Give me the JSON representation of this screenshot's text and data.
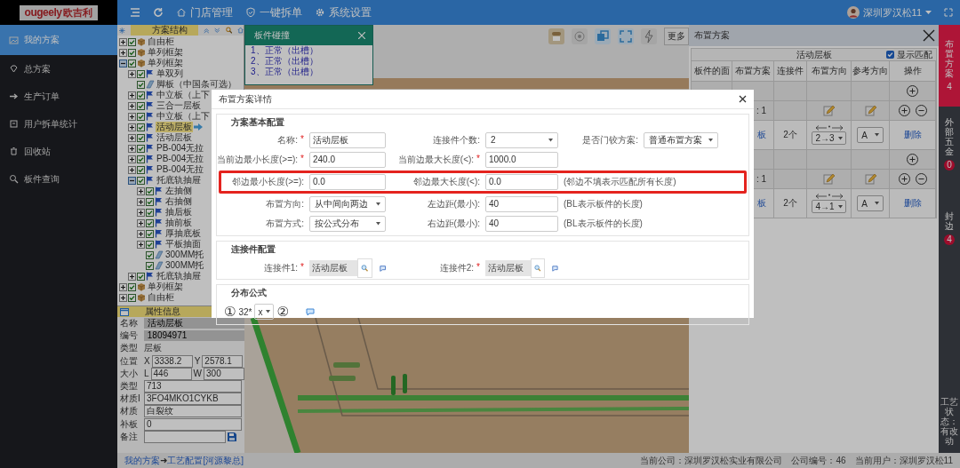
{
  "logo": {
    "wordmark": "ougeely",
    "brand": "欧吉利"
  },
  "nav": [
    {
      "label": "我的方案",
      "selected": true
    },
    {
      "label": "总方案",
      "selected": false
    },
    {
      "label": "生产订单",
      "selected": false
    },
    {
      "label": "用户拆单统计",
      "selected": false
    },
    {
      "label": "回收站",
      "selected": false
    },
    {
      "label": "板件查询",
      "selected": false
    }
  ],
  "topbar": {
    "menus": [
      "门店管理",
      "一键拆单",
      "系统设置"
    ],
    "user": "深圳罗汉松11"
  },
  "tree": {
    "title": "方案结构",
    "items": [
      {
        "name": "自由柜",
        "kind": "group",
        "checked": true,
        "expanded": false,
        "selected": false
      },
      {
        "name": "单列框架",
        "kind": "group",
        "checked": true,
        "expanded": false,
        "selected": false
      },
      {
        "name": "单列框架",
        "kind": "group",
        "checked": true,
        "expanded": true,
        "selected": false,
        "children": [
          {
            "name": "单双列",
            "kind": "flag",
            "checked": true,
            "expanded": false,
            "selected": false
          },
          {
            "name": "脚板（中国条可选）",
            "kind": "board",
            "checked": true,
            "selected": false
          },
          {
            "name": "中立板（上下",
            "kind": "flag",
            "checked": true,
            "expanded": false,
            "selected": false
          },
          {
            "name": "三合一层板",
            "kind": "flag",
            "checked": true,
            "expanded": false,
            "selected": false
          },
          {
            "name": "中立板（上下",
            "kind": "flag",
            "checked": true,
            "expanded": false,
            "selected": false
          },
          {
            "name": "活动层板",
            "kind": "flag",
            "checked": true,
            "expanded": false,
            "selected": true
          },
          {
            "name": "活动层板",
            "kind": "flag",
            "checked": true,
            "expanded": false,
            "selected": false
          },
          {
            "name": "PB-004无拉",
            "kind": "flag",
            "checked": true,
            "expanded": false,
            "selected": false
          },
          {
            "name": "PB-004无拉",
            "kind": "flag",
            "checked": true,
            "expanded": false,
            "selected": false
          },
          {
            "name": "PB-004无拉",
            "kind": "flag",
            "checked": true,
            "expanded": false,
            "selected": false
          },
          {
            "name": "托底轨抽屉",
            "kind": "flag",
            "checked": true,
            "expanded": true,
            "selected": false,
            "children": [
              {
                "name": "左抽侧",
                "kind": "flag",
                "checked": true,
                "expanded": false,
                "selected": false
              },
              {
                "name": "右抽侧",
                "kind": "flag",
                "checked": true,
                "expanded": false,
                "selected": false
              },
              {
                "name": "抽后板",
                "kind": "flag",
                "checked": true,
                "expanded": false,
                "selected": false
              },
              {
                "name": "抽前板",
                "kind": "flag",
                "checked": true,
                "expanded": false,
                "selected": false
              },
              {
                "name": "厚抽底板",
                "kind": "flag",
                "checked": true,
                "expanded": false,
                "selected": false
              },
              {
                "name": "平板抽面",
                "kind": "flag",
                "checked": true,
                "expanded": false,
                "selected": false
              },
              {
                "name": "300MM托",
                "kind": "board",
                "checked": true,
                "selected": false
              },
              {
                "name": "300MM托",
                "kind": "board",
                "checked": true,
                "selected": false
              }
            ]
          },
          {
            "name": "托底轨抽屉",
            "kind": "flag",
            "checked": true,
            "expanded": false,
            "selected": false
          }
        ]
      },
      {
        "name": "单列框架",
        "kind": "group",
        "checked": true,
        "expanded": false,
        "selected": false
      },
      {
        "name": "自由柜",
        "kind": "group",
        "checked": true,
        "expanded": false,
        "selected": false
      }
    ]
  },
  "properties": {
    "title": "属性信息",
    "rows": [
      {
        "label": "名称",
        "kind": "readonly",
        "value": "活动层板"
      },
      {
        "label": "编号",
        "kind": "readonly",
        "value": "18094971"
      },
      {
        "label": "类型",
        "kind": "text",
        "value": "层板"
      },
      {
        "label": "位置",
        "kind": "pair",
        "a_label": "X",
        "a": "3338.2",
        "b_label": "Y",
        "b": "2578.1"
      },
      {
        "label": "大小",
        "kind": "pair",
        "a_label": "L",
        "a": "446",
        "b_label": "W",
        "b": "300"
      },
      {
        "label": "类型",
        "kind": "input",
        "value": "713"
      },
      {
        "label": "材质I",
        "kind": "input",
        "value": "3FO4MKO1CYKB"
      },
      {
        "label": "材质",
        "kind": "input",
        "value": "白裂纹"
      },
      {
        "label": "补板",
        "kind": "input",
        "value": "0"
      },
      {
        "label": "备注",
        "kind": "note"
      }
    ]
  },
  "collision": {
    "title": "板件碰撞",
    "items": [
      "1、正常（出槽）",
      "2、正常（出槽）",
      "3、正常（出槽）"
    ]
  },
  "toolbar": {
    "more": "更多"
  },
  "layout_panel": {
    "title": "布置方案",
    "table_title": "活动层板",
    "show_match": {
      "label": "显示匹配",
      "checked": true
    },
    "columns": [
      "板件的面",
      "布置方案",
      "连接件",
      "布置方向",
      "参考方向",
      "操作"
    ],
    "rows": [
      {
        "kind": "add"
      },
      {
        "kind": "plan",
        "label": ": 1"
      },
      {
        "kind": "link",
        "name": "板",
        "count": "2个",
        "direction": "2→3",
        "reference": "A",
        "action": "删除"
      },
      {
        "kind": "add"
      },
      {
        "kind": "plan",
        "label": ": 1"
      },
      {
        "kind": "link",
        "name": "板",
        "count": "2个",
        "direction": "4→1",
        "reference": "A",
        "action": "删除"
      }
    ]
  },
  "side_tabs": [
    {
      "label": "布置方案",
      "count": "4",
      "selected": true
    },
    {
      "label": "外部五金",
      "count": "0",
      "selected": false
    },
    {
      "label": "封边",
      "count": "4",
      "selected": false
    }
  ],
  "side_status": "工艺状态：有改动",
  "breadcrumb": [
    {
      "kind": "link",
      "text": "我的方案"
    },
    {
      "kind": "sep",
      "text": "➜"
    },
    {
      "kind": "link",
      "text": "工艺配置[河源黎总]"
    }
  ],
  "status_bar": [
    "当前公司：深圳罗汉松实业有限公司",
    "公司编号：46",
    "当前用户：深圳罗汉松11"
  ],
  "modal": {
    "title": "布置方案详情",
    "sections": [
      {
        "title": "方案基本配置",
        "kind": "grid",
        "rows": [
          {
            "highlighted": false,
            "fields": [
              {
                "label": "名称:",
                "required_mark": "*",
                "kind": "input",
                "value": "活动层板"
              },
              {
                "label": "连接件个数:",
                "kind": "select",
                "value": "2"
              },
              {
                "label": "是否门铰方案:",
                "kind": "select",
                "value": "普通布置方案"
              }
            ]
          },
          {
            "highlighted": false,
            "fields": [
              {
                "label": "当前边最小长度(>=):",
                "required_mark": "*",
                "kind": "input",
                "value": "240.0"
              },
              {
                "label": "当前边最大长度(<):",
                "required_mark": "*",
                "kind": "input",
                "value": "1000.0"
              }
            ]
          },
          {
            "highlighted": true,
            "fields": [
              {
                "label": "邻边最小长度(>=):",
                "kind": "input",
                "value": "0.0"
              },
              {
                "label": "邻边最大长度(<):",
                "kind": "input",
                "value": "0.0"
              },
              {
                "kind": "note",
                "text": "(邻边不填表示匹配所有长度)"
              }
            ]
          },
          {
            "highlighted": false,
            "fields": [
              {
                "label": "布置方向:",
                "kind": "select",
                "value": "从中间向两边"
              },
              {
                "label": "左边距(最小):",
                "kind": "input",
                "value": "40"
              },
              {
                "kind": "note",
                "text": "(BL表示板件的长度)"
              }
            ]
          },
          {
            "highlighted": false,
            "fields": [
              {
                "label": "布置方式:",
                "kind": "select",
                "value": "按公式分布"
              },
              {
                "label": "右边距(最小):",
                "kind": "input",
                "value": "40"
              },
              {
                "kind": "note",
                "text": "(BL表示板件的长度)"
              }
            ]
          }
        ]
      },
      {
        "title": "连接件配置",
        "kind": "grid",
        "rows": [
          {
            "highlighted": false,
            "fields": [
              {
                "label": "连接件1:",
                "required_mark": "*",
                "kind": "lookup",
                "value": "活动层板"
              },
              {
                "label": "连接件2:",
                "required_mark": "*",
                "kind": "lookup",
                "value": "活动层板"
              }
            ]
          }
        ]
      },
      {
        "title": "分布公式",
        "kind": "formula",
        "items": [
          {
            "kind": "circle",
            "text": "①"
          },
          {
            "kind": "text",
            "text": "32*"
          },
          {
            "kind": "select",
            "value": "x"
          },
          {
            "kind": "circle",
            "text": "②"
          },
          {
            "kind": "comment"
          }
        ]
      }
    ]
  }
}
